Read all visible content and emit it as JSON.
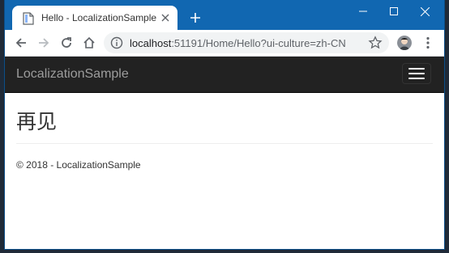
{
  "browser": {
    "tab_title": "Hello - LocalizationSample",
    "url_host": "localhost",
    "url_rest": ":51191/Home/Hello?ui-culture=zh-CN"
  },
  "app": {
    "brand": "LocalizationSample"
  },
  "page": {
    "heading": "再见",
    "footer": "© 2018 - LocalizationSample"
  },
  "colors": {
    "titlebar": "#1167b1",
    "navbar": "#222222",
    "brand_text": "#9d9d9d"
  },
  "icons": [
    "page-icon",
    "close-icon",
    "plus-icon",
    "minimize-icon",
    "maximize-icon",
    "close-icon",
    "back-icon",
    "forward-icon",
    "reload-icon",
    "home-icon",
    "info-icon",
    "star-icon",
    "avatar",
    "more-icon",
    "hamburger-icon"
  ]
}
